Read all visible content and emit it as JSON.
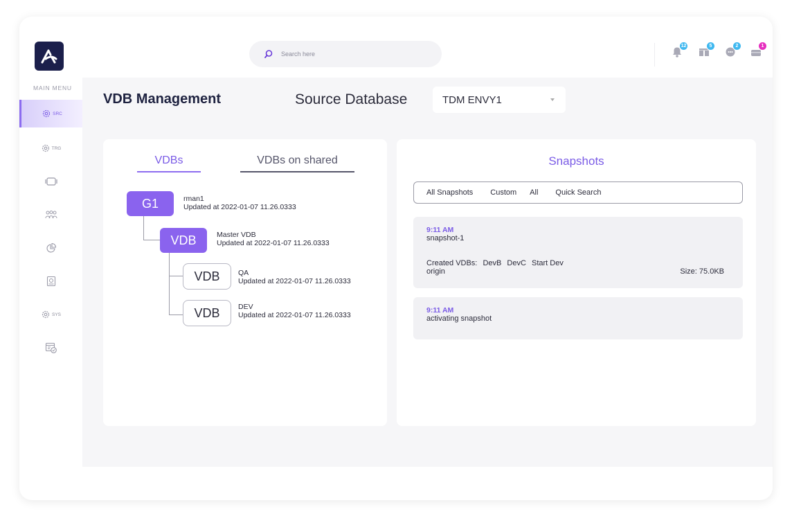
{
  "colors": {
    "accent": "#8a63ee",
    "logo_bg": "#1b1f4b",
    "badge_blue": "#3fb8f0",
    "badge_pink": "#e62fbf"
  },
  "header": {
    "search_placeholder": "Search here",
    "notifications": [
      {
        "icon": "bell-icon",
        "count": "12"
      },
      {
        "icon": "gift-icon",
        "count": "5"
      },
      {
        "icon": "chat-icon",
        "count": "2"
      },
      {
        "icon": "inbox-icon",
        "count": "1"
      }
    ]
  },
  "sidebar": {
    "title": "MAIN MENU",
    "items": [
      {
        "icon": "gear-icon",
        "label": "SRC"
      },
      {
        "icon": "gear-icon",
        "label": "TRG"
      },
      {
        "icon": "cards-icon",
        "label": ""
      },
      {
        "icon": "users-icon",
        "label": ""
      },
      {
        "icon": "pie-chart-icon",
        "label": ""
      },
      {
        "icon": "storage-icon",
        "label": ""
      },
      {
        "icon": "gear-icon",
        "label": "SYS"
      },
      {
        "icon": "calendar-check-icon",
        "label": ""
      }
    ]
  },
  "main": {
    "title": "VDB Management",
    "source_label": "Source Database",
    "source_value": "TDM ENVY1"
  },
  "vdbs": {
    "tabs": [
      "VDBs",
      "VDBs on shared"
    ],
    "tree": [
      {
        "badge": "G1",
        "name": "rman1",
        "updated": "Updated at 2022-01-07 11.26.0333"
      },
      {
        "badge": "VDB",
        "name": "Master VDB",
        "updated": "Updated at 2022-01-07 11.26.0333"
      },
      {
        "badge": "VDB",
        "name": "QA",
        "updated": "Updated at 2022-01-07 11.26.0333"
      },
      {
        "badge": "VDB",
        "name": "DEV",
        "updated": "Updated at 2022-01-07 11.26.0333"
      }
    ]
  },
  "snapshots": {
    "title": "Snapshots",
    "filters": [
      "All Snapshots",
      "Custom",
      "All",
      "Quick Search"
    ],
    "items": [
      {
        "time": "9:11 AM",
        "name": "snapshot-1",
        "created_label": "Created VDBs:",
        "created": [
          "DevB",
          "DevC",
          "Start Dev"
        ],
        "origin": "origin",
        "size": "Size: 75.0KB"
      },
      {
        "time": "9:11 AM",
        "name": "activating snapshot"
      }
    ]
  }
}
